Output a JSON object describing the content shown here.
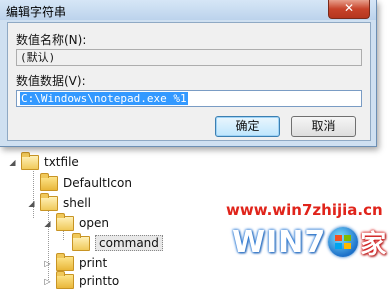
{
  "dialog": {
    "title": "编辑字符串",
    "close_glyph": "✕",
    "value_name_label": "数值名称(N):",
    "value_name": "(默认)",
    "value_data_label": "数值数据(V):",
    "value_data": "C:\\Windows\\notepad.exe %1",
    "ok_label": "确定",
    "cancel_label": "取消"
  },
  "tree": {
    "items": [
      {
        "label": "txtfile",
        "expander": "◢"
      },
      {
        "label": "DefaultIcon",
        "expander": ""
      },
      {
        "label": "shell",
        "expander": "◢"
      },
      {
        "label": "open",
        "expander": "◢"
      },
      {
        "label": "command",
        "expander": ""
      },
      {
        "label": "print",
        "expander": "▷"
      },
      {
        "label": "printto",
        "expander": "▷"
      }
    ]
  },
  "watermark": {
    "url": "www.win7zhijia.cn",
    "logo_left": "WIN7",
    "logo_right": "家"
  },
  "colors": {
    "selection": "#3399ff",
    "watermark_red": "#e0241b",
    "watermark_blue": "#2a7bd8"
  }
}
